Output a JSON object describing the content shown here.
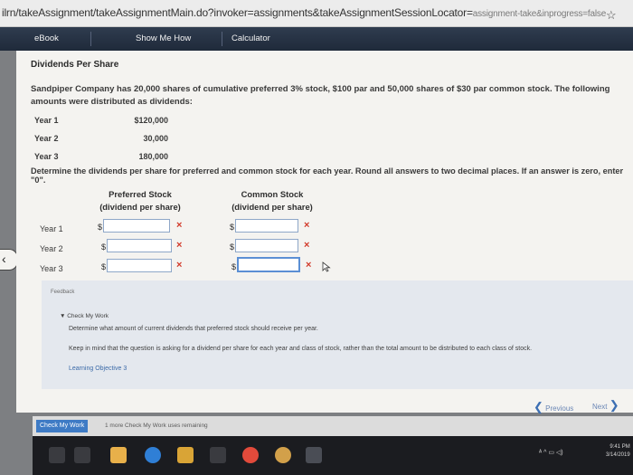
{
  "browser": {
    "url_main": "ilrn/takeAssignment/takeAssignmentMain.do?invoker=assignments&takeAssignmentSessionLocator=",
    "url_rest": "assignment-take&inprogress=false"
  },
  "toolbar": {
    "ebook": "eBook",
    "show_me_how": "Show Me How",
    "calculator": "Calculator"
  },
  "section_title": "Dividends Per Share",
  "problem_text": "Sandpiper Company has 20,000 shares of cumulative preferred 3% stock, $100 par and 50,000 shares of $30 par common stock. The following amounts were distributed as dividends:",
  "distributions": [
    {
      "year": "Year 1",
      "amount": "$120,000"
    },
    {
      "year": "Year 2",
      "amount": "30,000"
    },
    {
      "year": "Year 3",
      "amount": "180,000"
    }
  ],
  "instructions": "Determine the dividends per share for preferred and common stock for each year. Round all answers to two decimal places. If an answer is zero, enter \"0\".",
  "table": {
    "preferred_header_1": "Preferred Stock",
    "preferred_header_2": "(dividend per share)",
    "common_header_1": "Common Stock",
    "common_header_2": "(dividend per share)",
    "currency": "$",
    "rows": [
      {
        "label": "Year 1",
        "preferred": "",
        "common": "",
        "preferred_status": "×",
        "common_status": "×"
      },
      {
        "label": "Year 2",
        "preferred": "",
        "common": "",
        "preferred_status": "×",
        "common_status": "×"
      },
      {
        "label": "Year 3",
        "preferred": "",
        "common": "",
        "preferred_status": "×",
        "common_status": "×"
      }
    ]
  },
  "feedback": {
    "label": "Feedback",
    "check_my_work": "▼ Check My Work",
    "line1": "Determine what amount of current dividends that preferred stock should receive per year.",
    "line2": "Keep in mind that the question is asking for a dividend per share for each year and class of stock, rather than the total amount to be distributed to each class of stock.",
    "objective": "Learning Objective 3"
  },
  "nav": {
    "previous": "Previous",
    "next": "Next"
  },
  "bottom": {
    "check_my_work_button": "Check My Work",
    "remaining": "1 more Check My Work uses remaining"
  },
  "taskbar": {
    "time": "9:41 PM",
    "date": "3/14/2019"
  },
  "colors": {
    "toolbar": "#26334a",
    "accent": "#3e7bc5",
    "error": "#d23a2a"
  }
}
